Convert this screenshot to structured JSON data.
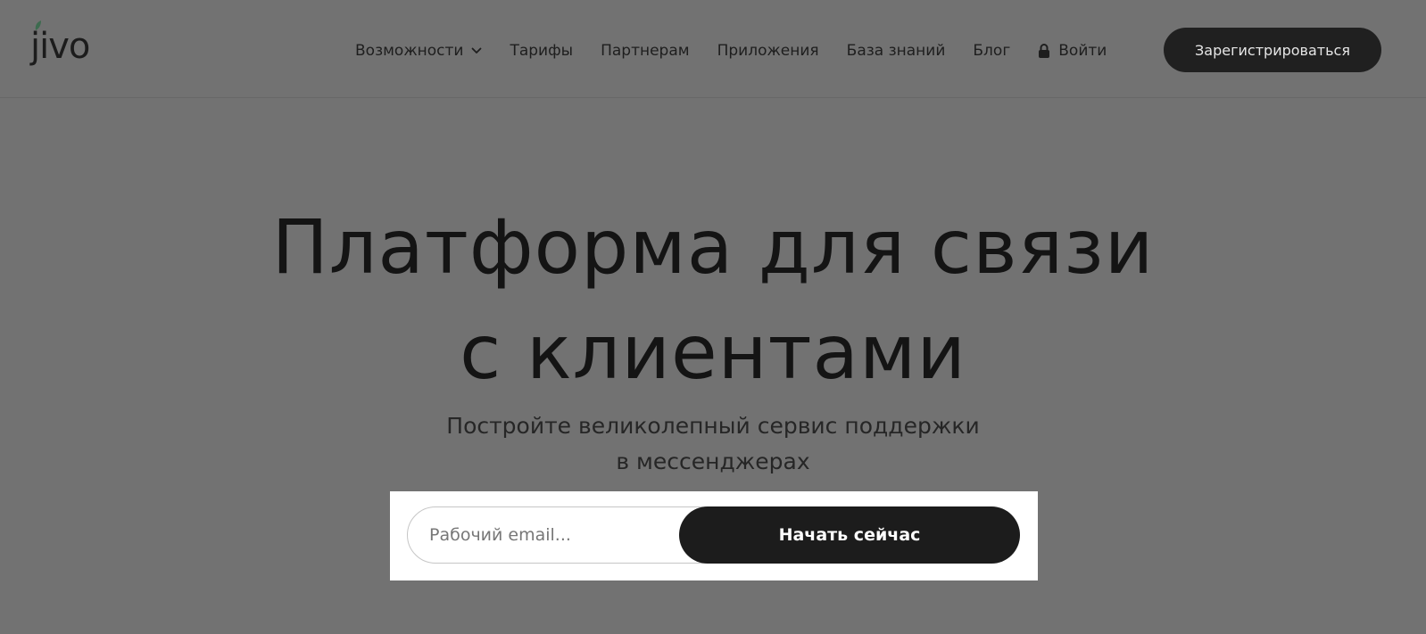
{
  "brand": {
    "logo_text": "jivo",
    "logo_icon": "leaf-icon",
    "accent_color": "#3d6b4f"
  },
  "nav": {
    "items": [
      {
        "label": "Возможности",
        "has_dropdown": true
      },
      {
        "label": "Тарифы"
      },
      {
        "label": "Партнерам"
      },
      {
        "label": "Приложения"
      },
      {
        "label": "База знаний"
      },
      {
        "label": "Блог"
      }
    ],
    "login_label": "Войти",
    "login_icon": "lock-icon",
    "register_label": "Зарегистрироваться"
  },
  "hero": {
    "title_line1": "Платформа для связи",
    "title_line2": "с клиентами",
    "subtitle_line1": "Постройте великолепный сервис поддержки",
    "subtitle_line2": "в мессенджерах"
  },
  "signup_form": {
    "email_placeholder": "Рабочий email...",
    "email_value": "",
    "submit_label": "Начать сейчас"
  },
  "colors": {
    "overlay_background": "#727272",
    "button_dark": "#1c1c1c",
    "form_highlight": "#ffffff"
  }
}
